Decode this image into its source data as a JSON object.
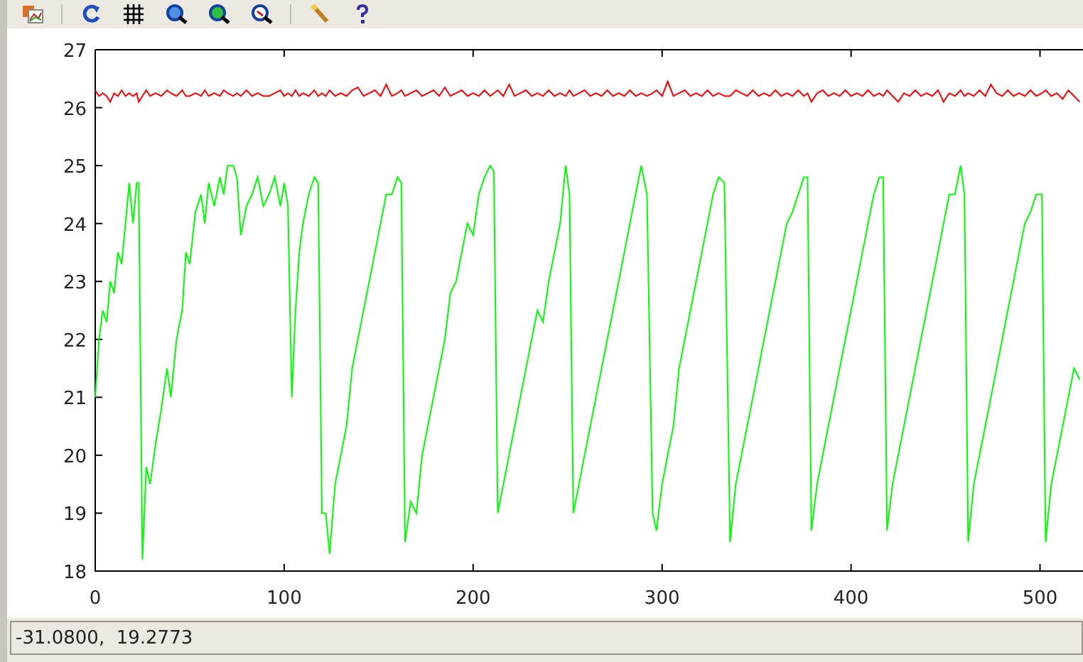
{
  "plot": {
    "chart_data": {
      "type": "line",
      "xlim": [
        0,
        522
      ],
      "ylim": [
        18,
        27
      ],
      "xticks": [
        0,
        100,
        200,
        300,
        400,
        500
      ],
      "yticks": [
        18,
        19,
        20,
        21,
        22,
        23,
        24,
        25,
        26,
        27
      ],
      "x": [
        0,
        2,
        4,
        6,
        8,
        10,
        12,
        14,
        16,
        18,
        20,
        22,
        23,
        25,
        27,
        29,
        32,
        35,
        38,
        40,
        43,
        46,
        48,
        50,
        53,
        56,
        58,
        60,
        63,
        66,
        68,
        70,
        73,
        75,
        77,
        80,
        83,
        86,
        89,
        92,
        95,
        98,
        100,
        102,
        104,
        106,
        108,
        110,
        113,
        116,
        118,
        120,
        122,
        124,
        127,
        130,
        133,
        136,
        139,
        142,
        145,
        148,
        151,
        154,
        157,
        160,
        162,
        164,
        167,
        170,
        173,
        176,
        179,
        182,
        185,
        188,
        191,
        194,
        197,
        200,
        203,
        206,
        209,
        211,
        213,
        216,
        219,
        222,
        225,
        228,
        231,
        234,
        237,
        240,
        243,
        246,
        249,
        251,
        253,
        256,
        259,
        262,
        265,
        268,
        271,
        274,
        277,
        280,
        283,
        286,
        289,
        292,
        295,
        297,
        300,
        303,
        306,
        309,
        312,
        315,
        318,
        321,
        324,
        327,
        330,
        333,
        336,
        339,
        342,
        345,
        348,
        351,
        354,
        357,
        360,
        363,
        366,
        369,
        372,
        375,
        377,
        379,
        382,
        385,
        388,
        391,
        394,
        397,
        400,
        403,
        406,
        409,
        412,
        415,
        417,
        419,
        422,
        425,
        428,
        431,
        434,
        437,
        440,
        443,
        446,
        449,
        452,
        455,
        458,
        460,
        462,
        465,
        468,
        471,
        474,
        477,
        480,
        483,
        486,
        489,
        492,
        495,
        498,
        501,
        503,
        506,
        509,
        512,
        515,
        518,
        521
      ],
      "series": [
        {
          "color": "#ff0000",
          "values": [
            26.3,
            26.2,
            26.25,
            26.2,
            26.1,
            26.25,
            26.2,
            26.3,
            26.2,
            26.25,
            26.2,
            26.25,
            26.1,
            26.2,
            26.3,
            26.2,
            26.25,
            26.2,
            26.3,
            26.25,
            26.2,
            26.3,
            26.2,
            26.2,
            26.25,
            26.2,
            26.3,
            26.2,
            26.25,
            26.2,
            26.3,
            26.25,
            26.2,
            26.25,
            26.2,
            26.3,
            26.2,
            26.25,
            26.2,
            26.2,
            26.25,
            26.3,
            26.2,
            26.25,
            26.2,
            26.3,
            26.2,
            26.25,
            26.2,
            26.3,
            26.2,
            26.25,
            26.2,
            26.3,
            26.2,
            26.25,
            26.2,
            26.3,
            26.35,
            26.2,
            26.25,
            26.3,
            26.2,
            26.4,
            26.2,
            26.25,
            26.3,
            26.2,
            26.25,
            26.3,
            26.2,
            26.25,
            26.3,
            26.2,
            26.35,
            26.2,
            26.25,
            26.3,
            26.2,
            26.25,
            26.2,
            26.3,
            26.2,
            26.25,
            26.3,
            26.2,
            26.4,
            26.2,
            26.25,
            26.3,
            26.2,
            26.25,
            26.2,
            26.3,
            26.2,
            26.25,
            26.2,
            26.3,
            26.2,
            26.25,
            26.3,
            26.2,
            26.25,
            26.2,
            26.3,
            26.2,
            26.25,
            26.2,
            26.3,
            26.2,
            26.25,
            26.2,
            26.25,
            26.3,
            26.2,
            26.45,
            26.2,
            26.25,
            26.3,
            26.2,
            26.25,
            26.2,
            26.3,
            26.2,
            26.25,
            26.2,
            26.2,
            26.3,
            26.25,
            26.2,
            26.3,
            26.2,
            26.25,
            26.2,
            26.3,
            26.2,
            26.25,
            26.2,
            26.3,
            26.2,
            26.25,
            26.1,
            26.25,
            26.3,
            26.2,
            26.25,
            26.2,
            26.3,
            26.2,
            26.25,
            26.2,
            26.3,
            26.2,
            26.25,
            26.2,
            26.3,
            26.2,
            26.1,
            26.25,
            26.2,
            26.3,
            26.2,
            26.25,
            26.2,
            26.3,
            26.1,
            26.25,
            26.2,
            26.3,
            26.2,
            26.25,
            26.2,
            26.3,
            26.2,
            26.4,
            26.25,
            26.2,
            26.3,
            26.2,
            26.25,
            26.2,
            26.3,
            26.2,
            26.25,
            26.3,
            26.2,
            26.25,
            26.15,
            26.3,
            26.2,
            26.1
          ]
        },
        {
          "color": "#00ff00",
          "values": [
            21.0,
            22.0,
            22.5,
            22.3,
            23.0,
            22.8,
            23.5,
            23.3,
            24.0,
            24.7,
            24.0,
            24.7,
            24.7,
            18.2,
            19.8,
            19.5,
            20.2,
            20.8,
            21.5,
            21.0,
            22.0,
            22.5,
            23.5,
            23.3,
            24.2,
            24.5,
            24.0,
            24.7,
            24.3,
            24.8,
            24.5,
            25.0,
            25.0,
            24.8,
            23.8,
            24.3,
            24.5,
            24.8,
            24.3,
            24.5,
            24.8,
            24.3,
            24.7,
            24.3,
            21.0,
            22.5,
            23.5,
            24.0,
            24.5,
            24.8,
            24.7,
            19.0,
            19.0,
            18.3,
            19.5,
            20.0,
            20.5,
            21.5,
            22.0,
            22.5,
            23.0,
            23.5,
            24.0,
            24.5,
            24.5,
            24.8,
            24.7,
            18.5,
            19.2,
            19.0,
            20.0,
            20.5,
            21.0,
            21.5,
            22.0,
            22.8,
            23.0,
            23.5,
            24.0,
            23.8,
            24.5,
            24.8,
            25.0,
            24.9,
            19.0,
            19.5,
            20.0,
            20.5,
            21.0,
            21.5,
            22.0,
            22.5,
            22.3,
            23.0,
            23.5,
            24.0,
            25.0,
            24.5,
            19.0,
            19.5,
            20.0,
            20.5,
            21.0,
            21.5,
            22.0,
            22.5,
            23.0,
            23.5,
            24.0,
            24.5,
            25.0,
            24.5,
            19.0,
            18.7,
            19.5,
            20.0,
            20.5,
            21.5,
            22.0,
            22.5,
            23.0,
            23.5,
            24.0,
            24.5,
            24.8,
            24.7,
            18.5,
            19.5,
            20.0,
            20.5,
            21.0,
            21.5,
            22.0,
            22.5,
            23.0,
            23.5,
            24.0,
            24.2,
            24.5,
            24.8,
            24.8,
            18.7,
            19.5,
            20.0,
            20.5,
            21.0,
            21.5,
            22.0,
            22.5,
            23.0,
            23.5,
            24.0,
            24.5,
            24.8,
            24.8,
            18.7,
            19.5,
            20.0,
            20.5,
            21.0,
            21.5,
            22.0,
            22.5,
            23.0,
            23.5,
            24.0,
            24.5,
            24.5,
            25.0,
            24.5,
            18.5,
            19.5,
            20.0,
            20.5,
            21.0,
            21.5,
            22.0,
            22.5,
            23.0,
            23.5,
            24.0,
            24.2,
            24.5,
            24.5,
            18.5,
            19.5,
            20.0,
            20.5,
            21.0,
            21.5,
            21.3
          ]
        }
      ]
    }
  },
  "status_bar": {
    "text": "-31.0800,  19.2773"
  }
}
